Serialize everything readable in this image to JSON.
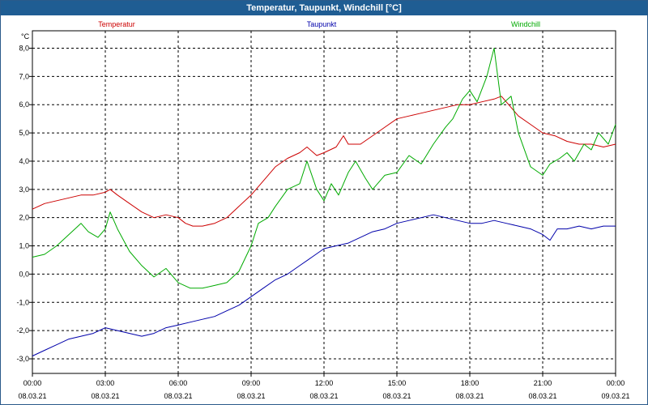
{
  "window": {
    "title": "Temperatur, Taupunkt, Windchill [°C]"
  },
  "chart_data": {
    "type": "line",
    "title": "Temperatur, Taupunkt, Windchill [°C]",
    "ylabel": "°C",
    "ylim": [
      -3.0,
      8.0
    ],
    "yticks": [
      "8,0",
      "7,0",
      "6,0",
      "5,0",
      "4,0",
      "3,0",
      "2,0",
      "1,0",
      "0,0",
      "-1,0",
      "-2,0",
      "-3,0"
    ],
    "xlim": [
      0,
      24
    ],
    "xticks": [
      {
        "time": "00:00",
        "date": "08.03.21"
      },
      {
        "time": "03:00",
        "date": "08.03.21"
      },
      {
        "time": "06:00",
        "date": "08.03.21"
      },
      {
        "time": "09:00",
        "date": "08.03.21"
      },
      {
        "time": "12:00",
        "date": "08.03.21"
      },
      {
        "time": "15:00",
        "date": "08.03.21"
      },
      {
        "time": "18:00",
        "date": "08.03.21"
      },
      {
        "time": "21:00",
        "date": "08.03.21"
      },
      {
        "time": "00:00",
        "date": "09.03.21"
      }
    ],
    "grid": true,
    "legend_position": "top",
    "series": [
      {
        "name": "Temperatur",
        "color": "#cc0000",
        "x": [
          0,
          0.5,
          1,
          1.5,
          2,
          2.5,
          3,
          3.2,
          3.5,
          4,
          4.5,
          5,
          5.5,
          6,
          6.3,
          6.6,
          7,
          7.5,
          8,
          8.5,
          9,
          9.5,
          10,
          10.5,
          11,
          11.3,
          11.7,
          12,
          12.5,
          12.8,
          13,
          13.5,
          14,
          14.5,
          15,
          15.5,
          16,
          16.5,
          17,
          17.5,
          18,
          18.5,
          19,
          19.3,
          19.7,
          20,
          20.5,
          21,
          21.5,
          22,
          22.5,
          23,
          23.5,
          24
        ],
        "y": [
          2.3,
          2.5,
          2.6,
          2.7,
          2.8,
          2.8,
          2.9,
          3.0,
          2.8,
          2.5,
          2.2,
          2.0,
          2.1,
          2.0,
          1.8,
          1.7,
          1.7,
          1.8,
          2.0,
          2.4,
          2.8,
          3.3,
          3.8,
          4.1,
          4.3,
          4.5,
          4.2,
          4.3,
          4.5,
          4.9,
          4.6,
          4.6,
          4.9,
          5.2,
          5.5,
          5.6,
          5.7,
          5.8,
          5.9,
          6.0,
          6.0,
          6.1,
          6.2,
          6.3,
          5.9,
          5.6,
          5.3,
          5.0,
          4.9,
          4.7,
          4.6,
          4.6,
          4.5,
          4.6
        ]
      },
      {
        "name": "Taupunkt",
        "color": "#0000aa",
        "x": [
          0,
          0.5,
          1,
          1.5,
          2,
          2.5,
          3,
          3.5,
          4,
          4.5,
          5,
          5.5,
          6,
          6.5,
          7,
          7.5,
          8,
          8.5,
          9,
          9.5,
          10,
          10.5,
          11,
          11.5,
          12,
          12.5,
          13,
          13.5,
          14,
          14.5,
          15,
          15.5,
          16,
          16.5,
          17,
          17.5,
          18,
          18.5,
          19,
          19.5,
          20,
          20.5,
          21,
          21.3,
          21.6,
          22,
          22.5,
          23,
          23.5,
          24
        ],
        "y": [
          -2.9,
          -2.7,
          -2.5,
          -2.3,
          -2.2,
          -2.1,
          -1.9,
          -2.0,
          -2.1,
          -2.2,
          -2.1,
          -1.9,
          -1.8,
          -1.7,
          -1.6,
          -1.5,
          -1.3,
          -1.1,
          -0.8,
          -0.5,
          -0.2,
          0.0,
          0.3,
          0.6,
          0.9,
          1.0,
          1.1,
          1.3,
          1.5,
          1.6,
          1.8,
          1.9,
          2.0,
          2.1,
          2.0,
          1.9,
          1.8,
          1.8,
          1.9,
          1.8,
          1.7,
          1.6,
          1.4,
          1.2,
          1.6,
          1.6,
          1.7,
          1.6,
          1.7,
          1.7
        ]
      },
      {
        "name": "Windchill",
        "color": "#00aa00",
        "x": [
          0,
          0.5,
          1,
          1.5,
          2,
          2.3,
          2.7,
          3,
          3.2,
          3.5,
          4,
          4.5,
          5,
          5.5,
          6,
          6.5,
          7,
          7.5,
          8,
          8.5,
          9,
          9.3,
          9.7,
          10,
          10.5,
          11,
          11.3,
          11.7,
          12,
          12.3,
          12.6,
          13,
          13.3,
          13.7,
          14,
          14.5,
          15,
          15.5,
          16,
          16.5,
          17,
          17.3,
          17.7,
          18,
          18.3,
          18.7,
          19,
          19.3,
          19.7,
          20,
          20.5,
          21,
          21.3,
          21.7,
          22,
          22.3,
          22.7,
          23,
          23.3,
          23.7,
          24
        ],
        "y": [
          0.6,
          0.7,
          1.0,
          1.4,
          1.8,
          1.5,
          1.3,
          1.6,
          2.2,
          1.6,
          0.8,
          0.3,
          -0.1,
          0.2,
          -0.3,
          -0.5,
          -0.5,
          -0.4,
          -0.3,
          0.1,
          1.0,
          1.8,
          2.0,
          2.4,
          3.0,
          3.2,
          4.0,
          3.0,
          2.6,
          3.2,
          2.8,
          3.6,
          4.0,
          3.4,
          3.0,
          3.5,
          3.6,
          4.2,
          3.9,
          4.6,
          5.2,
          5.5,
          6.2,
          6.5,
          6.1,
          7.0,
          8.0,
          6.0,
          6.3,
          5.0,
          3.8,
          3.5,
          3.9,
          4.1,
          4.3,
          4.0,
          4.6,
          4.4,
          5.0,
          4.6,
          5.3
        ]
      }
    ]
  }
}
